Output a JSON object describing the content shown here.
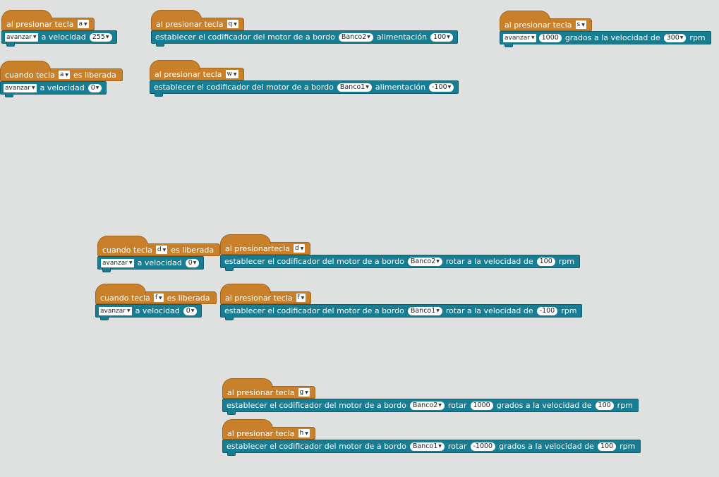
{
  "scripts": {
    "s1": {
      "hat": {
        "label": "al presionar tecla",
        "key": "a"
      },
      "cmd": {
        "action": "avanzar",
        "label": "a velocidad",
        "speed": "255"
      }
    },
    "s2": {
      "hat": {
        "label": "cuando tecla",
        "key": "a",
        "suffix": "es liberada"
      },
      "cmd": {
        "action": "avanzar",
        "label": "a velocidad",
        "speed": "0"
      }
    },
    "s3": {
      "hat": {
        "label": "al presionar tecla",
        "key": "q"
      },
      "cmd": {
        "label": "establecer el codificador del motor de a bordo",
        "bank": "Banco2",
        "label2": "alimentación",
        "power": "100"
      }
    },
    "s4": {
      "hat": {
        "label": "al presionar tecla",
        "key": "w"
      },
      "cmd": {
        "label": "establecer el codificador del motor de a bordo",
        "bank": "Banco1",
        "label2": "alimentación",
        "power": "-100"
      }
    },
    "s5": {
      "hat": {
        "label": "al presionar tecla",
        "key": "s"
      },
      "cmd": {
        "action": "avanzar",
        "degrees": "1000",
        "label": "grados a la velocidad de",
        "speed": "300",
        "unit": "rpm"
      }
    },
    "s6": {
      "hat": {
        "label": "cuando tecla",
        "key": "d",
        "suffix": "es liberada"
      },
      "cmd": {
        "action": "avanzar",
        "label": "a velocidad",
        "speed": "0"
      }
    },
    "s7": {
      "hat": {
        "label": "cuando tecla",
        "key": "f",
        "suffix": "es liberada"
      },
      "cmd": {
        "action": "avanzar",
        "label": "a velocidad",
        "speed": "0"
      }
    },
    "s8": {
      "hat": {
        "label": "al presionartecla",
        "key": "d"
      },
      "cmd": {
        "label": "establecer el codificador del motor de a bordo",
        "bank": "Banco2",
        "label2": "rotar a la velocidad de",
        "speed": "100",
        "unit": "rpm"
      }
    },
    "s9": {
      "hat": {
        "label": "al presionar tecla",
        "key": "f"
      },
      "cmd": {
        "label": "establecer el codificador del motor de a bordo",
        "bank": "Banco1",
        "label2": "rotar a la velocidad de",
        "speed": "-100",
        "unit": "rpm"
      }
    },
    "s10": {
      "hat": {
        "label": "al presionar tecla",
        "key": "g"
      },
      "cmd": {
        "label": "establecer el codificador del motor de a bordo",
        "bank": "Banco2",
        "label2": "rotar",
        "degrees": "1000",
        "label3": "grados a la velocidad de",
        "speed": "100",
        "unit": "rpm"
      }
    },
    "s11": {
      "hat": {
        "label": "al presionar tecla",
        "key": "h"
      },
      "cmd": {
        "label": "establecer el codificador del motor de a bordo",
        "bank": "Banco1",
        "label2": "rotar",
        "degrees": "-1000",
        "label3": "grados a la velocidad de",
        "speed": "100",
        "unit": "rpm"
      }
    }
  },
  "icons": {
    "dropdown": "triangle-down-icon"
  },
  "colors": {
    "event_block": "#c8802a",
    "motor_block": "#167d92",
    "canvas": "#dfe1e1"
  }
}
